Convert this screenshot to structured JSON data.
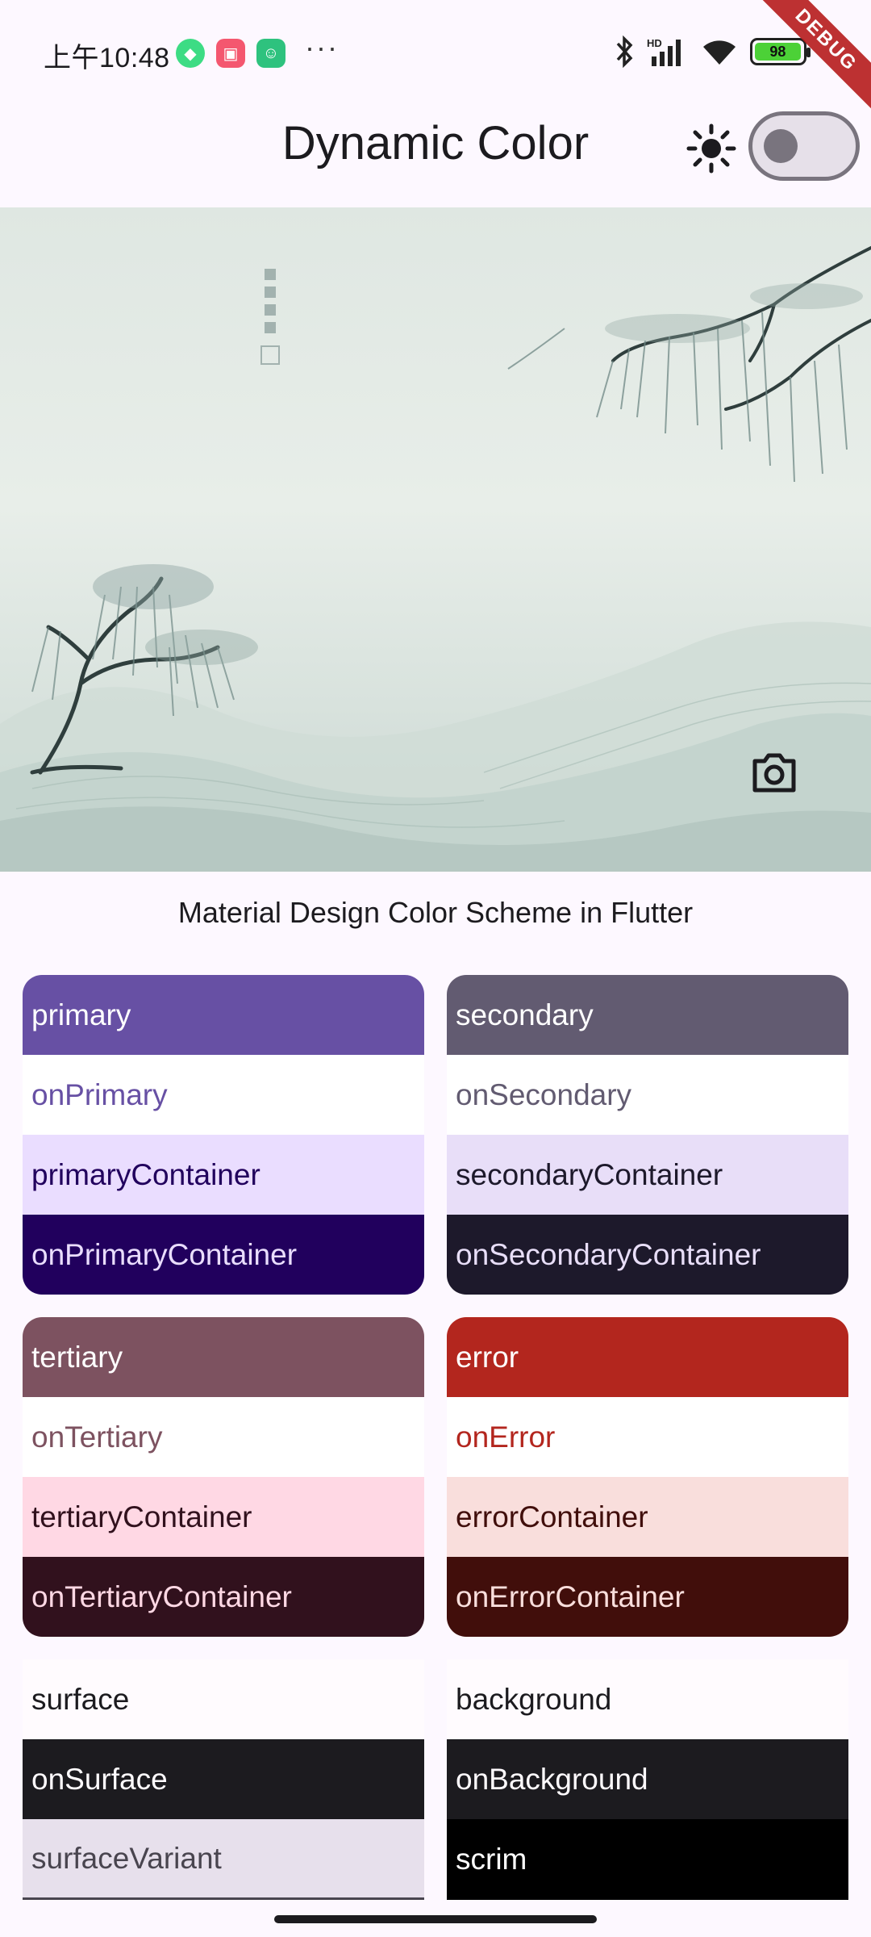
{
  "status_bar": {
    "time": "上午10:48",
    "battery": "98"
  },
  "debug_banner": "DEBUG",
  "app_bar": {
    "title": "Dynamic Color",
    "theme_toggle": "off"
  },
  "caption": "Material Design Color Scheme in Flutter",
  "colors": {
    "primary": "#6750a4",
    "secondary": "#625b71",
    "tertiary": "#7d5260",
    "error": "#b3261e"
  },
  "schemes": {
    "primary": {
      "main": "primary",
      "on": "onPrimary",
      "container": "primaryContainer",
      "on_container": "onPrimaryContainer"
    },
    "secondary": {
      "main": "secondary",
      "on": "onSecondary",
      "container": "secondaryContainer",
      "on_container": "onSecondaryContainer"
    },
    "tertiary": {
      "main": "tertiary",
      "on": "onTertiary",
      "container": "tertiaryContainer",
      "on_container": "onTertiaryContainer"
    },
    "error": {
      "main": "error",
      "on": "onError",
      "container": "errorContainer",
      "on_container": "onErrorContainer"
    }
  },
  "surfaces": {
    "surface": "surface",
    "on_surface": "onSurface",
    "surface_variant": "surfaceVariant",
    "background": "background",
    "on_background": "onBackground",
    "scrim": "scrim"
  }
}
